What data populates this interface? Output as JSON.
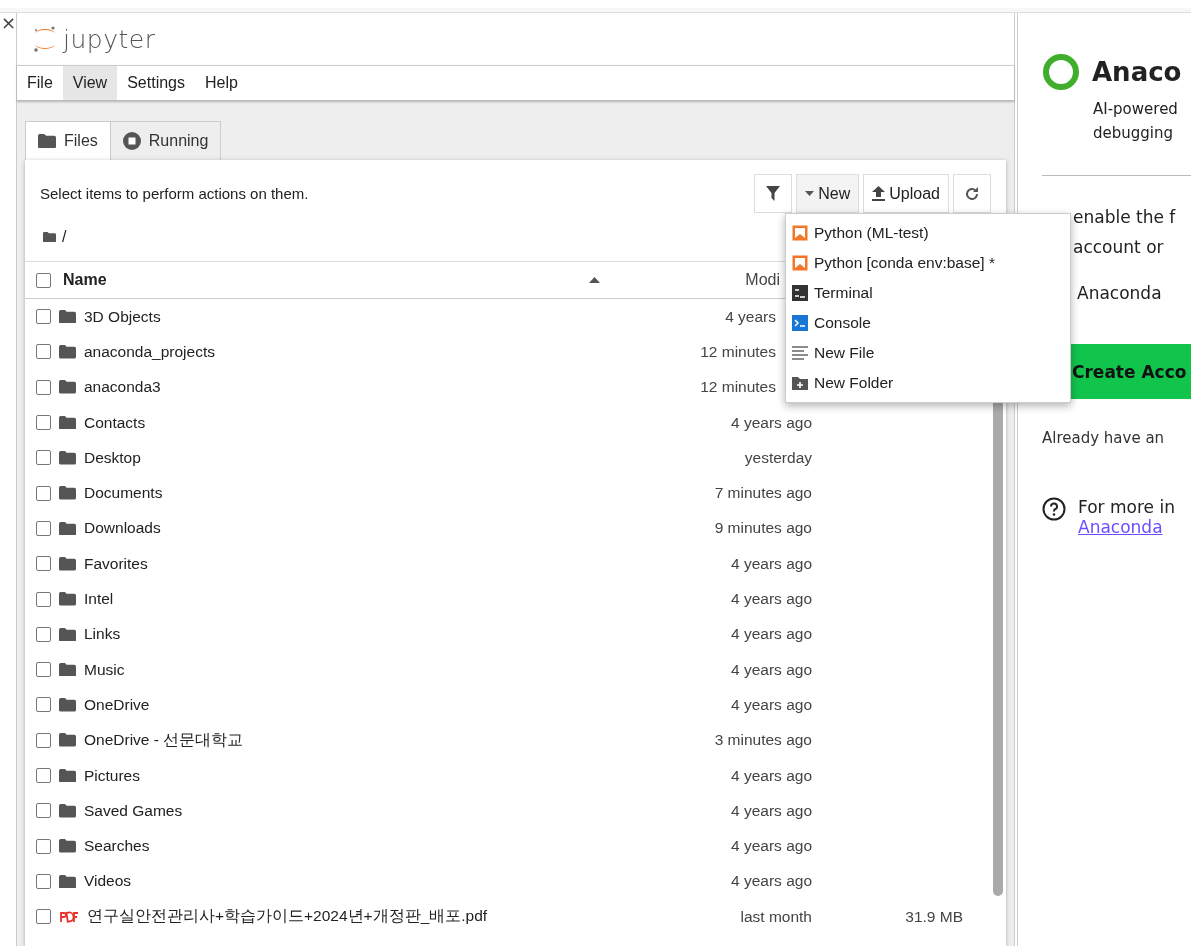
{
  "left_pane": {
    "close": "×"
  },
  "header": {
    "logo": "jupyter"
  },
  "menu": [
    {
      "label": "File",
      "selected": false
    },
    {
      "label": "View",
      "selected": true
    },
    {
      "label": "Settings",
      "selected": false
    },
    {
      "label": "Help",
      "selected": false
    }
  ],
  "tabs": [
    {
      "label": "Files",
      "kind": "files",
      "selected": true
    },
    {
      "label": "Running",
      "kind": "running",
      "selected": false
    }
  ],
  "toolbar": {
    "hint": "Select items to perform actions on them.",
    "buttons": [
      {
        "kind": "filter"
      },
      {
        "kind": "new",
        "label": "New",
        "expanded": true
      },
      {
        "kind": "upload",
        "label": "Upload"
      },
      {
        "kind": "refresh"
      }
    ]
  },
  "breadcrumb": "/",
  "table": {
    "columns": [
      "Name",
      "Modi"
    ],
    "all_checked": false,
    "rows": [
      {
        "name": "3D Objects",
        "kind": "folder",
        "modified": "4 years",
        "checked": false
      },
      {
        "name": "anaconda_projects",
        "kind": "folder",
        "modified": "12 minutes",
        "checked": false
      },
      {
        "name": "anaconda3",
        "kind": "folder",
        "modified": "12 minutes",
        "checked": false
      },
      {
        "name": "Contacts",
        "kind": "folder",
        "modified": "4 years ago",
        "checked": false
      },
      {
        "name": "Desktop",
        "kind": "folder",
        "modified": "yesterday",
        "checked": false
      },
      {
        "name": "Documents",
        "kind": "folder",
        "modified": "7 minutes ago",
        "checked": false
      },
      {
        "name": "Downloads",
        "kind": "folder",
        "modified": "9 minutes ago",
        "checked": false
      },
      {
        "name": "Favorites",
        "kind": "folder",
        "modified": "4 years ago",
        "checked": false
      },
      {
        "name": "Intel",
        "kind": "folder",
        "modified": "4 years ago",
        "checked": false
      },
      {
        "name": "Links",
        "kind": "folder",
        "modified": "4 years ago",
        "checked": false
      },
      {
        "name": "Music",
        "kind": "folder",
        "modified": "4 years ago",
        "checked": false
      },
      {
        "name": "OneDrive",
        "kind": "folder",
        "modified": "4 years ago",
        "checked": false
      },
      {
        "name": "OneDrive - 선문대학교",
        "kind": "folder",
        "modified": "3 minutes ago",
        "checked": false
      },
      {
        "name": "Pictures",
        "kind": "folder",
        "modified": "4 years ago",
        "checked": false
      },
      {
        "name": "Saved Games",
        "kind": "folder",
        "modified": "4 years ago",
        "checked": false
      },
      {
        "name": "Searches",
        "kind": "folder",
        "modified": "4 years ago",
        "checked": false
      },
      {
        "name": "Videos",
        "kind": "folder",
        "modified": "4 years ago",
        "checked": false
      },
      {
        "name": "연구실안전관리사+학습가이드+2024년+개정판_배포.pdf",
        "kind": "pdf",
        "modified": "last month",
        "size": "31.9 MB",
        "checked": false
      }
    ]
  },
  "new_menu": [
    {
      "label": "Python (ML-test)",
      "kind": "notebook"
    },
    {
      "label": "Python [conda env:base] *",
      "kind": "notebook"
    },
    {
      "label": "Terminal",
      "kind": "terminal"
    },
    {
      "label": "Console",
      "kind": "console"
    },
    {
      "label": "New File",
      "kind": "file"
    },
    {
      "label": "New Folder",
      "kind": "folder"
    }
  ],
  "anaconda": {
    "title": "Anaco",
    "subtitle": [
      "AI-powered",
      "debugging"
    ],
    "lines": [
      "enable the f",
      "account or"
    ],
    "item": "Anaconda",
    "button": "Create Acco",
    "login": "Already have an",
    "info": "For more in",
    "link": "Anaconda"
  }
}
